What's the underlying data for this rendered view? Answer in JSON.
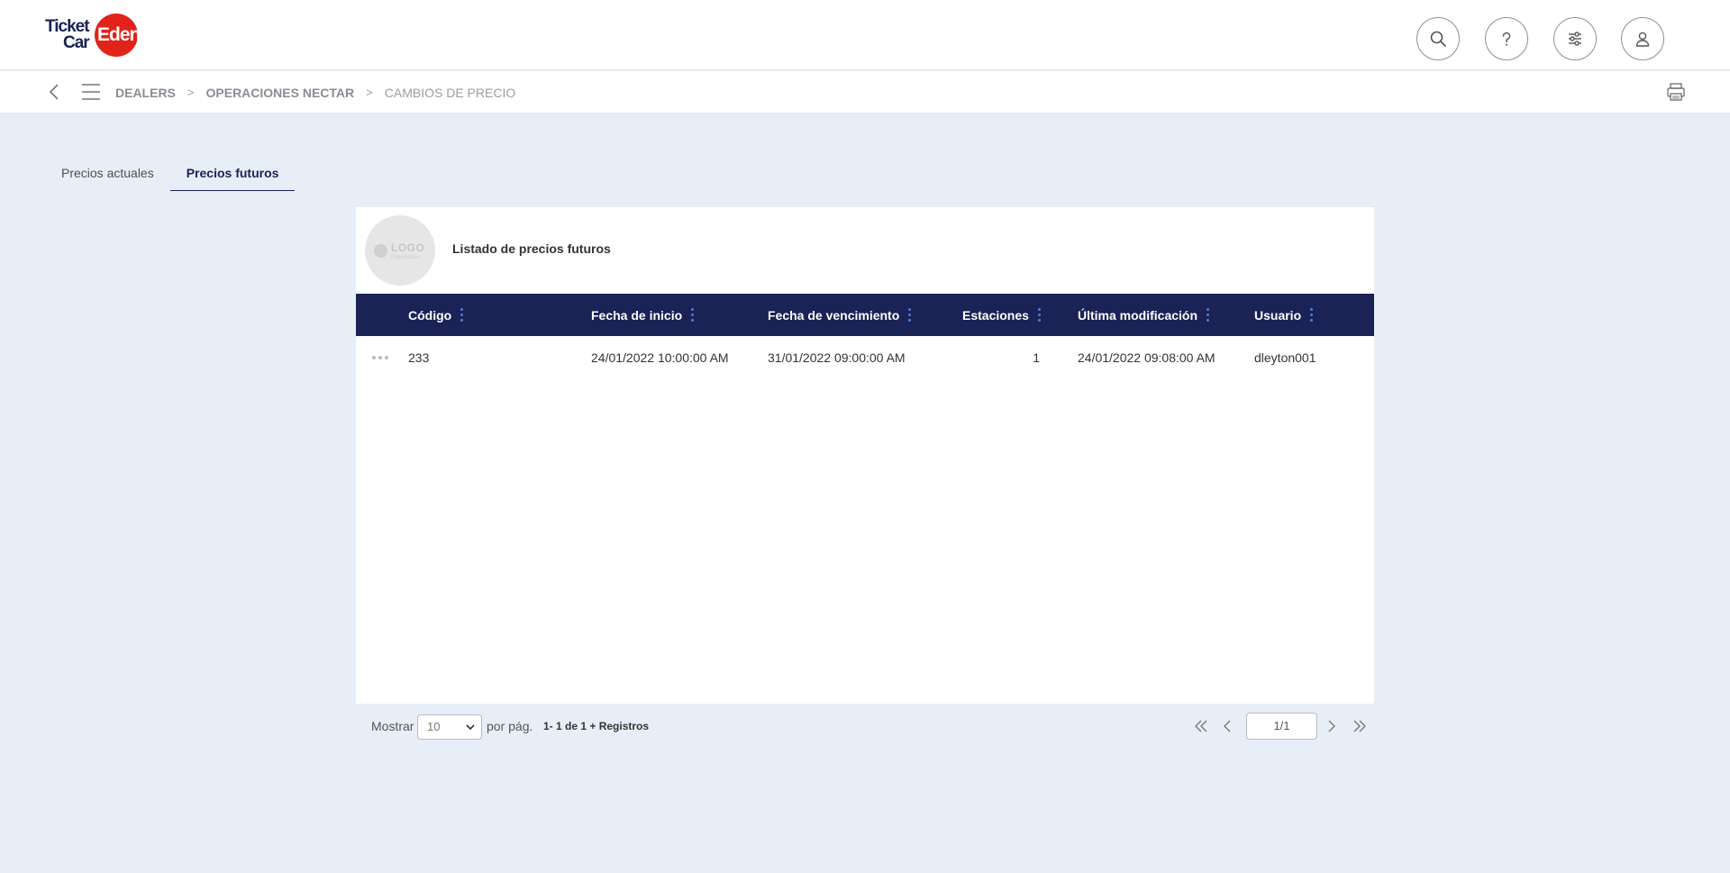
{
  "header": {
    "logo": {
      "word1": "Ticket",
      "word2": "Car",
      "word3": "Edenred"
    },
    "actions": [
      {
        "name": "search",
        "icon": "search-icon"
      },
      {
        "name": "help",
        "icon": "help-icon"
      },
      {
        "name": "settings",
        "icon": "sliders-icon"
      },
      {
        "name": "profile",
        "icon": "user-icon"
      }
    ],
    "brand_color": "#1a2256",
    "accent_color": "#e2231a"
  },
  "breadcrumb": {
    "items": [
      "DEALERS",
      "OPERACIONES NECTAR",
      "CAMBIOS DE PRECIO"
    ],
    "separator": ">"
  },
  "tabs": [
    {
      "label": "Precios actuales",
      "active": false
    },
    {
      "label": "Precios futuros",
      "active": true
    }
  ],
  "card": {
    "logo_placeholder": {
      "text": "LOGO",
      "sub": "Placeholder"
    },
    "title": "Listado de precios futuros"
  },
  "table": {
    "columns": [
      "Código",
      "Fecha de inicio",
      "Fecha de vencimiento",
      "Estaciones",
      "Última modificación",
      "Usuario"
    ],
    "rows": [
      {
        "codigo": "233",
        "fecha_inicio": "24/01/2022 10:00:00 AM",
        "fecha_vencimiento": "31/01/2022 09:00:00 AM",
        "estaciones": "1",
        "ultima_modificacion": "24/01/2022 09:08:00 AM",
        "usuario": "dleyton001"
      }
    ]
  },
  "pagination": {
    "show_label": "Mostrar",
    "per_page": "10",
    "per_page_label": "por pág.",
    "count_text": "1- 1 de 1 + Registros",
    "page": "1/1"
  }
}
